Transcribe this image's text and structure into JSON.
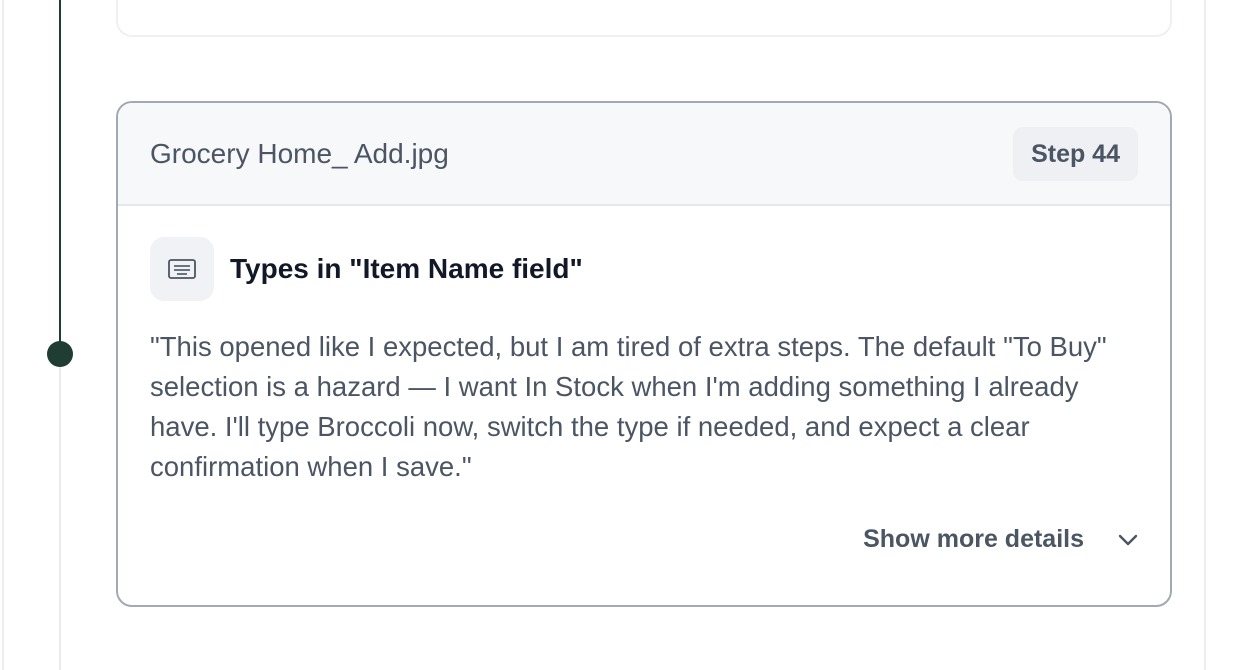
{
  "step": {
    "title": "Grocery Home_ Add.jpg",
    "badge": "Step 44",
    "action": "Types in \"Item Name field\"",
    "quote": "\"This opened like I expected, but I am tired of extra steps. The default \"To Buy\" selection is a hazard — I want In Stock when I'm adding something I already have. I'll type Broccoli now, switch the type if needed, and expect a clear confirmation when I save.\"",
    "details_label": "Show more details"
  },
  "icons": {
    "action": "keyboard-icon",
    "toggle": "chevron-down-icon"
  },
  "colors": {
    "timeline": "#1f3d33",
    "card_border": "#a3a8b2",
    "header_bg": "#f7f8fa"
  }
}
